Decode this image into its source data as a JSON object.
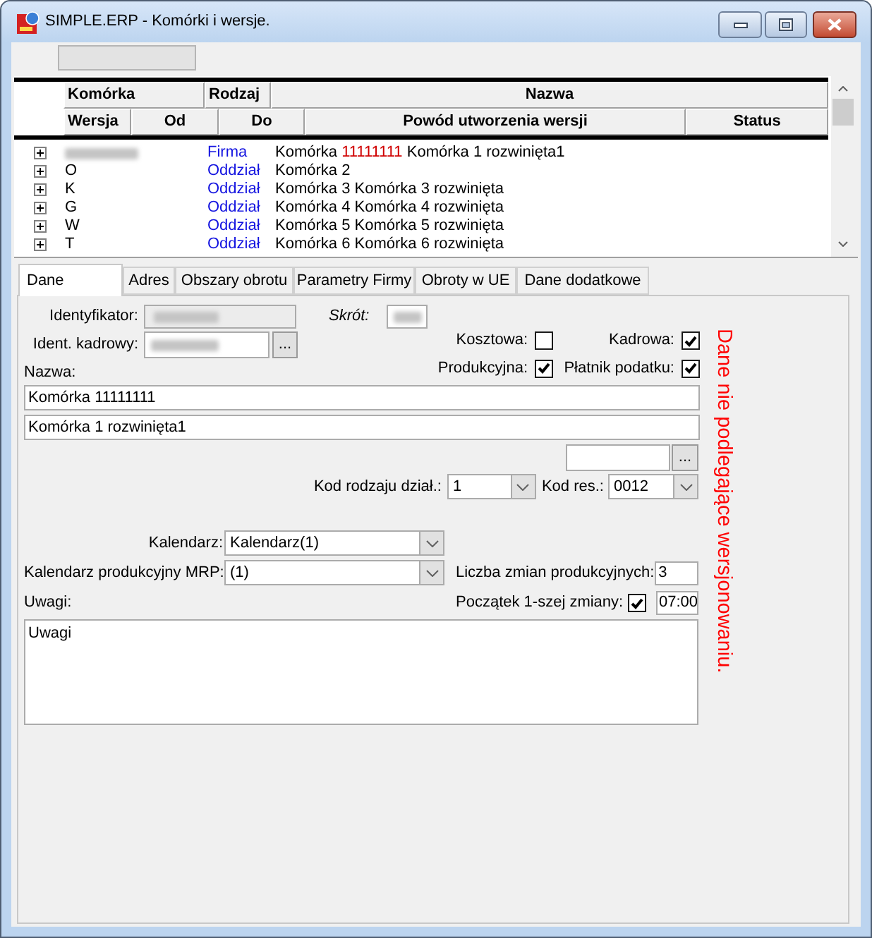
{
  "window": {
    "title": "SIMPLE.ERP - Komórki i wersje."
  },
  "grid": {
    "header_top": [
      "Komórka",
      "Rodzaj",
      "Nazwa"
    ],
    "header_bottom": [
      "Wersja",
      "Od",
      "Do",
      "Powód utworzenia wersji",
      "Status"
    ],
    "rows": [
      {
        "expanded": false,
        "type": "Firma",
        "name": [
          {
            "text": "Komórka ",
            "highlighted": false
          },
          {
            "text": "11111111",
            "highlighted": true
          },
          {
            "text": " Komórka 1 rozwinięta1",
            "highlighted": false
          }
        ]
      },
      {
        "expanded": false,
        "code": "O",
        "type": "Oddział",
        "name": [
          {
            "text": "Komórka 2",
            "highlighted": false
          }
        ]
      },
      {
        "expanded": false,
        "code": "K",
        "type": "Oddział",
        "name": [
          {
            "text": "Komórka 3 Komórka 3 rozwinięta",
            "highlighted": false
          }
        ]
      },
      {
        "expanded": false,
        "code": "G",
        "type": "Oddział",
        "name": [
          {
            "text": "Komórka 4 Komórka 4 rozwinięta",
            "highlighted": false
          }
        ]
      },
      {
        "expanded": false,
        "code": "W",
        "type": "Oddział",
        "name": [
          {
            "text": "Komórka 5 Komórka 5 rozwinięta",
            "highlighted": false
          }
        ]
      },
      {
        "expanded": false,
        "code": "T",
        "type": "Oddział",
        "name": [
          {
            "text": "Komórka 6 Komórka 6 rozwinięta",
            "highlighted": false
          }
        ]
      }
    ]
  },
  "tabs": [
    {
      "label": "Dane",
      "selected": true
    },
    {
      "label": "Adres",
      "selected": false
    },
    {
      "label": "Obszary obrotu",
      "selected": false
    },
    {
      "label": "Parametry Firmy",
      "selected": false
    },
    {
      "label": "Obroty w UE",
      "selected": false
    },
    {
      "label": "Dane dodatkowe",
      "selected": false
    }
  ],
  "form": {
    "id_field": {
      "label": "Identyfikator:",
      "disabled": true
    },
    "short_label": "Skrót:",
    "hr_id": {
      "label": "Ident. kadrowy:",
      "button": "..."
    },
    "checkboxes": [
      {
        "label": "Kosztowa:",
        "checked": false
      },
      {
        "label": "Kadrowa:",
        "checked": true
      },
      {
        "label": "Produkcyjna:",
        "checked": true
      },
      {
        "label": "Płatnik podatku:",
        "checked": true
      }
    ],
    "name_label": "Nazwa:",
    "name_value": "Komórka 11111111",
    "description_value": "Komórka 1 rozwinięta1",
    "lookup": {
      "button": "..."
    },
    "dept_code": {
      "label": "Kod rodzaju dział.:",
      "value": "1"
    },
    "res_code": {
      "label": "Kod res.:",
      "value": "0012"
    },
    "calendar": {
      "label": "Kalendarz:",
      "value": "Kalendarz(1)"
    },
    "mrp_calendar": {
      "label": "Kalendarz produkcyjny MRP:",
      "value": "(1)"
    },
    "shifts": {
      "label": "Liczba zmian produkcyjnych:",
      "value": "3"
    },
    "notes_label": "Uwagi:",
    "first_shift": {
      "label": "Początek 1-szej zmiany:",
      "checked": true,
      "value": "07:00"
    },
    "notes_value": "Uwagi",
    "side_note": "Dane nie podlegające wersjonowaniu."
  }
}
